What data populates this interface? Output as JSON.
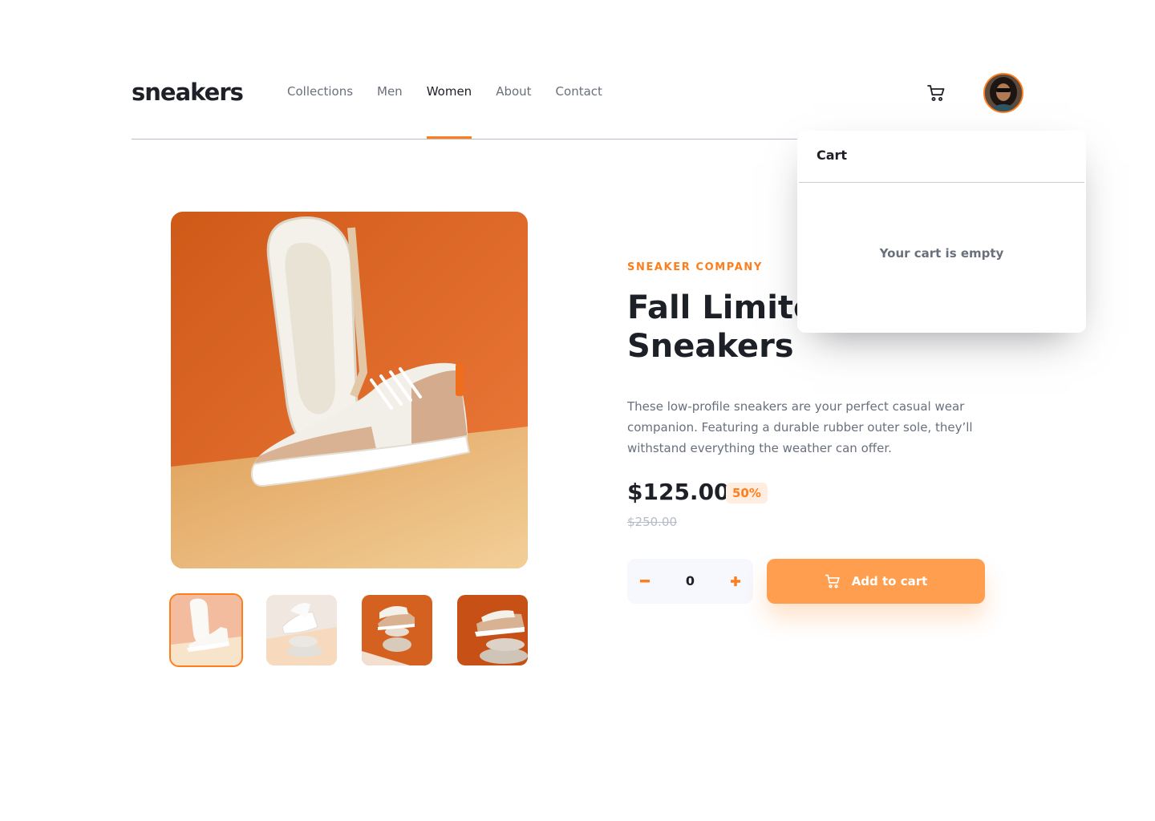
{
  "header": {
    "logo": "sneakers",
    "nav": [
      "Collections",
      "Men",
      "Women",
      "About",
      "Contact"
    ],
    "active_nav": "Women",
    "cart_icon": "cart-icon",
    "avatar_icon": "user-avatar"
  },
  "gallery": {
    "main_image": "sneaker-product-photo",
    "thumbnails": [
      "thumbnail-1",
      "thumbnail-2",
      "thumbnail-3",
      "thumbnail-4"
    ],
    "selected_thumbnail": 1
  },
  "product": {
    "company": "SNEAKER COMPANY",
    "title": "Fall Limited Edition Sneakers",
    "description": "These low-profile sneakers are your perfect casual wear companion.  Featuring a durable rubber outer sole, they’ll withstand everything the weather can offer.",
    "price": "$125.00",
    "discount": "50%",
    "old_price": "$250.00",
    "quantity": "0",
    "minus_icon": "minus-icon",
    "plus_icon": "plus-icon",
    "add_to_cart": "Add to cart"
  },
  "cart_popover": {
    "title": "Cart",
    "empty_message": "Your cart is empty"
  },
  "colors": {
    "accent": "#ff7e1b",
    "accent_light": "#ffede0",
    "dark": "#1d2026",
    "grayish": "#69707d"
  }
}
